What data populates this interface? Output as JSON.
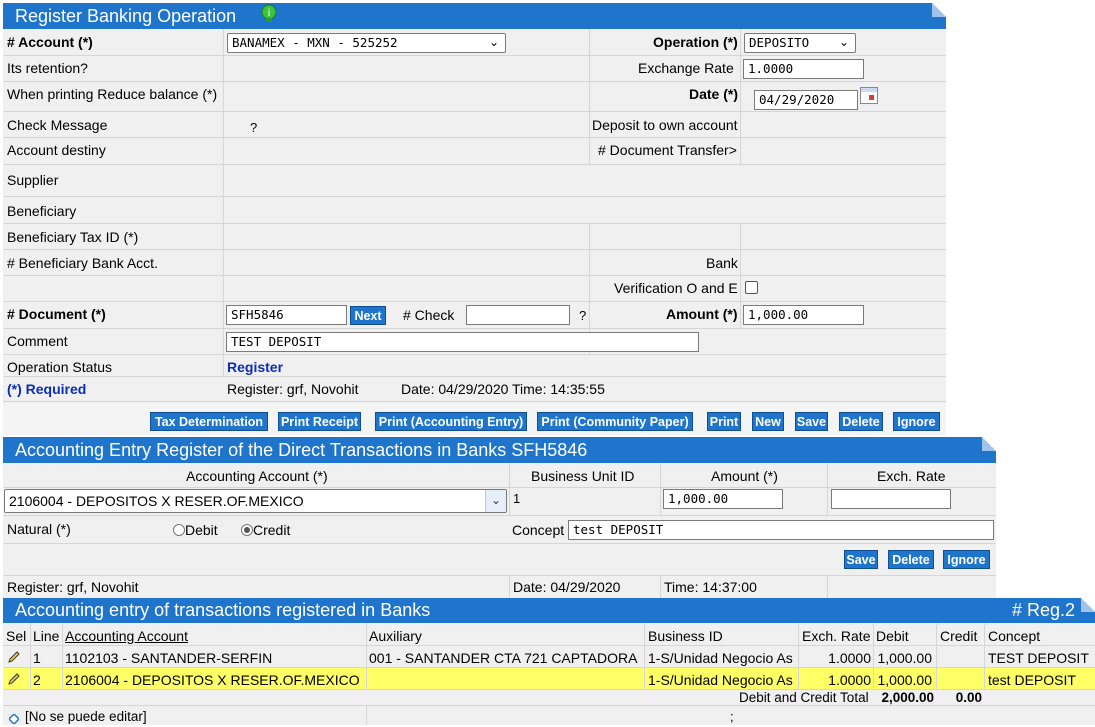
{
  "header": {
    "title": "Register Banking Operation"
  },
  "form": {
    "account_label": "# Account (*)",
    "account_value": "BANAMEX - MXN - 525252",
    "operation_label": "Operation (*)",
    "operation_value": "DEPOSITO",
    "retention_label": "Its retention?",
    "exchange_rate_label": "Exchange Rate",
    "exchange_rate_value": "1.0000",
    "reduce_balance_label": "When printing Reduce balance (*)",
    "date_label": "Date (*)",
    "date_value": "04/29/2020",
    "check_message_label": "Check Message",
    "check_message_value": "?",
    "deposit_own_label": "Deposit to own account",
    "account_destiny_label": "Account destiny",
    "doc_transfer_label": "# Document Transfer>",
    "supplier_label": "Supplier",
    "beneficiary_label": "Beneficiary",
    "beneficiary_tax_label": "Beneficiary Tax ID (*)",
    "beneficiary_bank_acct_label": "# Beneficiary Bank Acct.",
    "bank_label": "Bank",
    "verification_label": "Verification O and E",
    "document_label": "# Document (*)",
    "document_value": "SFH5846",
    "next_label": "Next",
    "check_label": "# Check",
    "check_value": "",
    "check_q": "?",
    "amount_label": "Amount (*)",
    "amount_value": "1,000.00",
    "comment_label": "Comment",
    "comment_value": "TEST DEPOSIT",
    "op_status_label": "Operation Status",
    "op_status_value": "Register",
    "required_label": "(*) Required",
    "register_info": "Register: grf, Novohit",
    "date_info": "Date: 04/29/2020",
    "time_info": "Time: 14:35:55"
  },
  "toolbar": {
    "tax_determination": "Tax Determination",
    "print_receipt": "Print Receipt",
    "print_accounting": "Print (Accounting Entry)",
    "print_community": "Print (Community Paper)",
    "print": "Print",
    "new": "New",
    "save": "Save",
    "delete": "Delete",
    "ignore": "Ignore"
  },
  "entry": {
    "title": "Accounting Entry Register of the Direct Transactions in Banks SFH5846",
    "col_account": "Accounting Account (*)",
    "col_business_unit": "Business Unit ID",
    "col_amount": "Amount (*)",
    "col_exch_rate": "Exch. Rate",
    "account_value": "2106004 - DEPOSITOS X RESER.OF.MEXICO",
    "business_unit_value": "1",
    "amount_value": "1,000.00",
    "exch_rate_value": "",
    "natural_label": "Natural (*)",
    "debit_label": "Debit",
    "credit_label": "Credit",
    "concept_label": "Concept",
    "concept_value": "test DEPOSIT",
    "save": "Save",
    "delete": "Delete",
    "ignore": "Ignore",
    "register_info": "Register: grf, Novohit",
    "date_info": "Date: 04/29/2020",
    "time_info": "Time:  14:37:00"
  },
  "list": {
    "title": "Accounting entry of transactions registered in Banks",
    "reg_count": "# Reg.2",
    "headers": [
      "Sel",
      "Line",
      "Accounting Account",
      "Auxiliary",
      "Business ID",
      "Exch. Rate",
      "Debit",
      "Credit",
      "Concept"
    ],
    "rows": [
      {
        "line": "1",
        "account": "1102103 - SANTANDER-SERFIN",
        "auxiliary": "001 - SANTANDER CTA 721 CAPTADORA",
        "business": "1-S/Unidad Negocio As",
        "rate": "1.0000",
        "debit": "1,000.00",
        "credit": "",
        "concept": "TEST DEPOSIT"
      },
      {
        "line": "2",
        "account": "2106004 - DEPOSITOS X RESER.OF.MEXICO",
        "auxiliary": "",
        "business": "1-S/Unidad Negocio As",
        "rate": "1.0000",
        "debit": "1,000.00",
        "credit": "",
        "concept": "test DEPOSIT"
      }
    ],
    "total_label": "Debit and Credit Total",
    "total_debit": "2,000.00",
    "total_credit": "0.00",
    "footer_note": "[No se puede editar]",
    "footer_semicolon": ";"
  },
  "colors": {
    "accent": "#1f75cc",
    "highlight_row": "#ffff66",
    "grid_bg": "#f0f0f0"
  }
}
